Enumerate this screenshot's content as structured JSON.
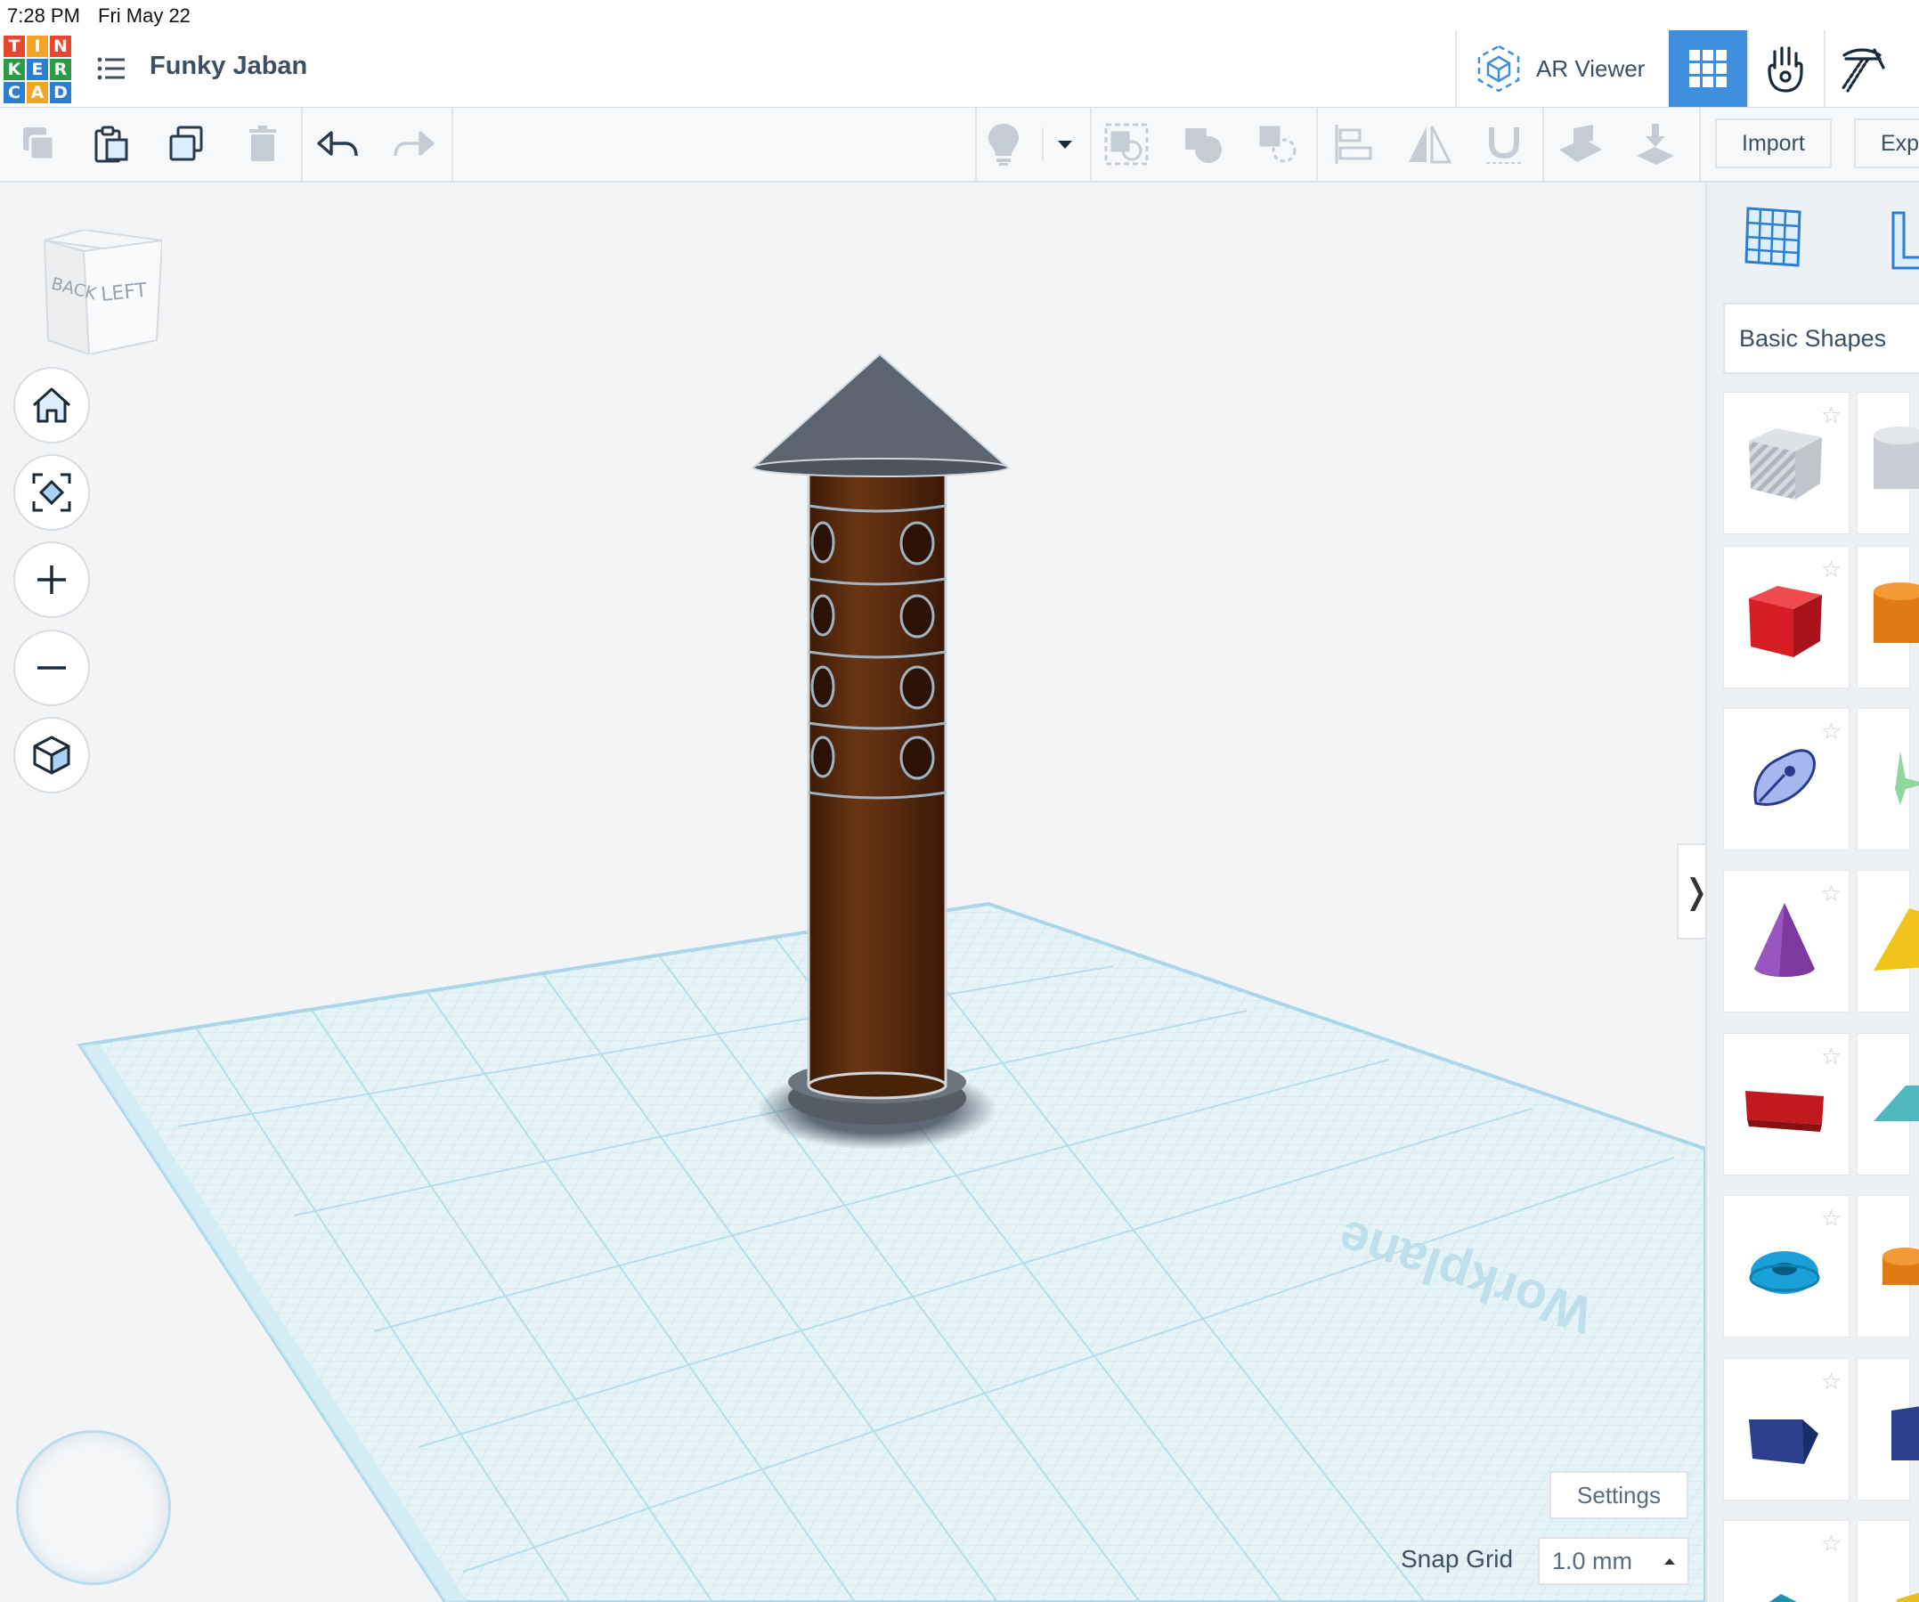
{
  "status_bar": {
    "time": "7:28 PM",
    "date": "Fri May 22"
  },
  "app": {
    "logo_letters": [
      "T",
      "I",
      "N",
      "K",
      "E",
      "R",
      "C",
      "A",
      "D"
    ],
    "logo_colors": [
      "#e8462f",
      "#f3a52a",
      "#e8462f",
      "#2d9a47",
      "#2a7fd2",
      "#2d9a47",
      "#2a7fd2",
      "#f3a52a",
      "#2a7fd2"
    ],
    "design_title": "Funky Jaban",
    "ar_viewer_label": "AR Viewer",
    "accent_color": "#3f8fde"
  },
  "toolbar": {
    "import_label": "Import",
    "export_label": "Exp",
    "tools": [
      "copy-icon",
      "paste-icon",
      "duplicate-icon",
      "delete-icon",
      "undo-icon",
      "redo-icon",
      "light-bulb-icon",
      "dropdown-caret-icon",
      "group-icon",
      "solid-icon",
      "hole-icon",
      "align-icon",
      "mirror-icon",
      "magnet-icon",
      "workplane-icon",
      "ruler-drop-icon"
    ]
  },
  "viewport": {
    "viewcube_faces": {
      "back": "BACK",
      "left": "LEFT"
    },
    "workplane_label": "Workplane",
    "settings_label": "Settings",
    "snap_grid_label": "Snap Grid",
    "snap_grid_value": "1.0 mm",
    "object_colors": {
      "roof": "#5b6570",
      "body": "#5a2b10",
      "base": "#545c66"
    }
  },
  "shapes_panel": {
    "category": "Basic Shapes",
    "shapes": [
      {
        "name": "Box Hole",
        "color": "#b8bec6"
      },
      {
        "name": "Box",
        "color": "#d81e25"
      },
      {
        "name": "Scribble",
        "color": "#a8b6ef"
      },
      {
        "name": "Cone",
        "color": "#7c3aa0"
      },
      {
        "name": "Text",
        "color": "#c01a20"
      },
      {
        "name": "Torus",
        "color": "#1aa0d8"
      },
      {
        "name": "Wedge",
        "color": "#2b3f8c"
      },
      {
        "name": "Pyramid",
        "color": "#1f8fb0"
      }
    ]
  }
}
